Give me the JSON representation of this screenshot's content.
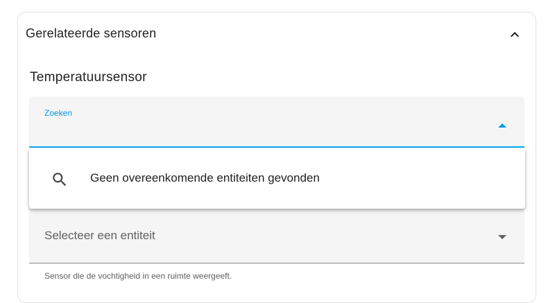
{
  "card": {
    "title": "Gerelateerde sensoren",
    "collapse_icon": "chevron-up-icon"
  },
  "temperature": {
    "label": "Temperatuursensor",
    "search": {
      "label": "Zoeken",
      "value": "",
      "placeholder": "",
      "toggle_icon": "caret-up-icon",
      "accent_color": "#03a9f4"
    },
    "dropdown": {
      "icon": "search-icon",
      "empty_text": "Geen overeenkomende entiteiten gevonden"
    }
  },
  "humidity": {
    "placeholder": "Selecteer een entiteit",
    "toggle_icon": "caret-down-icon",
    "helper": "Sensor die de vochtigheid in een ruimte weergeeft."
  }
}
